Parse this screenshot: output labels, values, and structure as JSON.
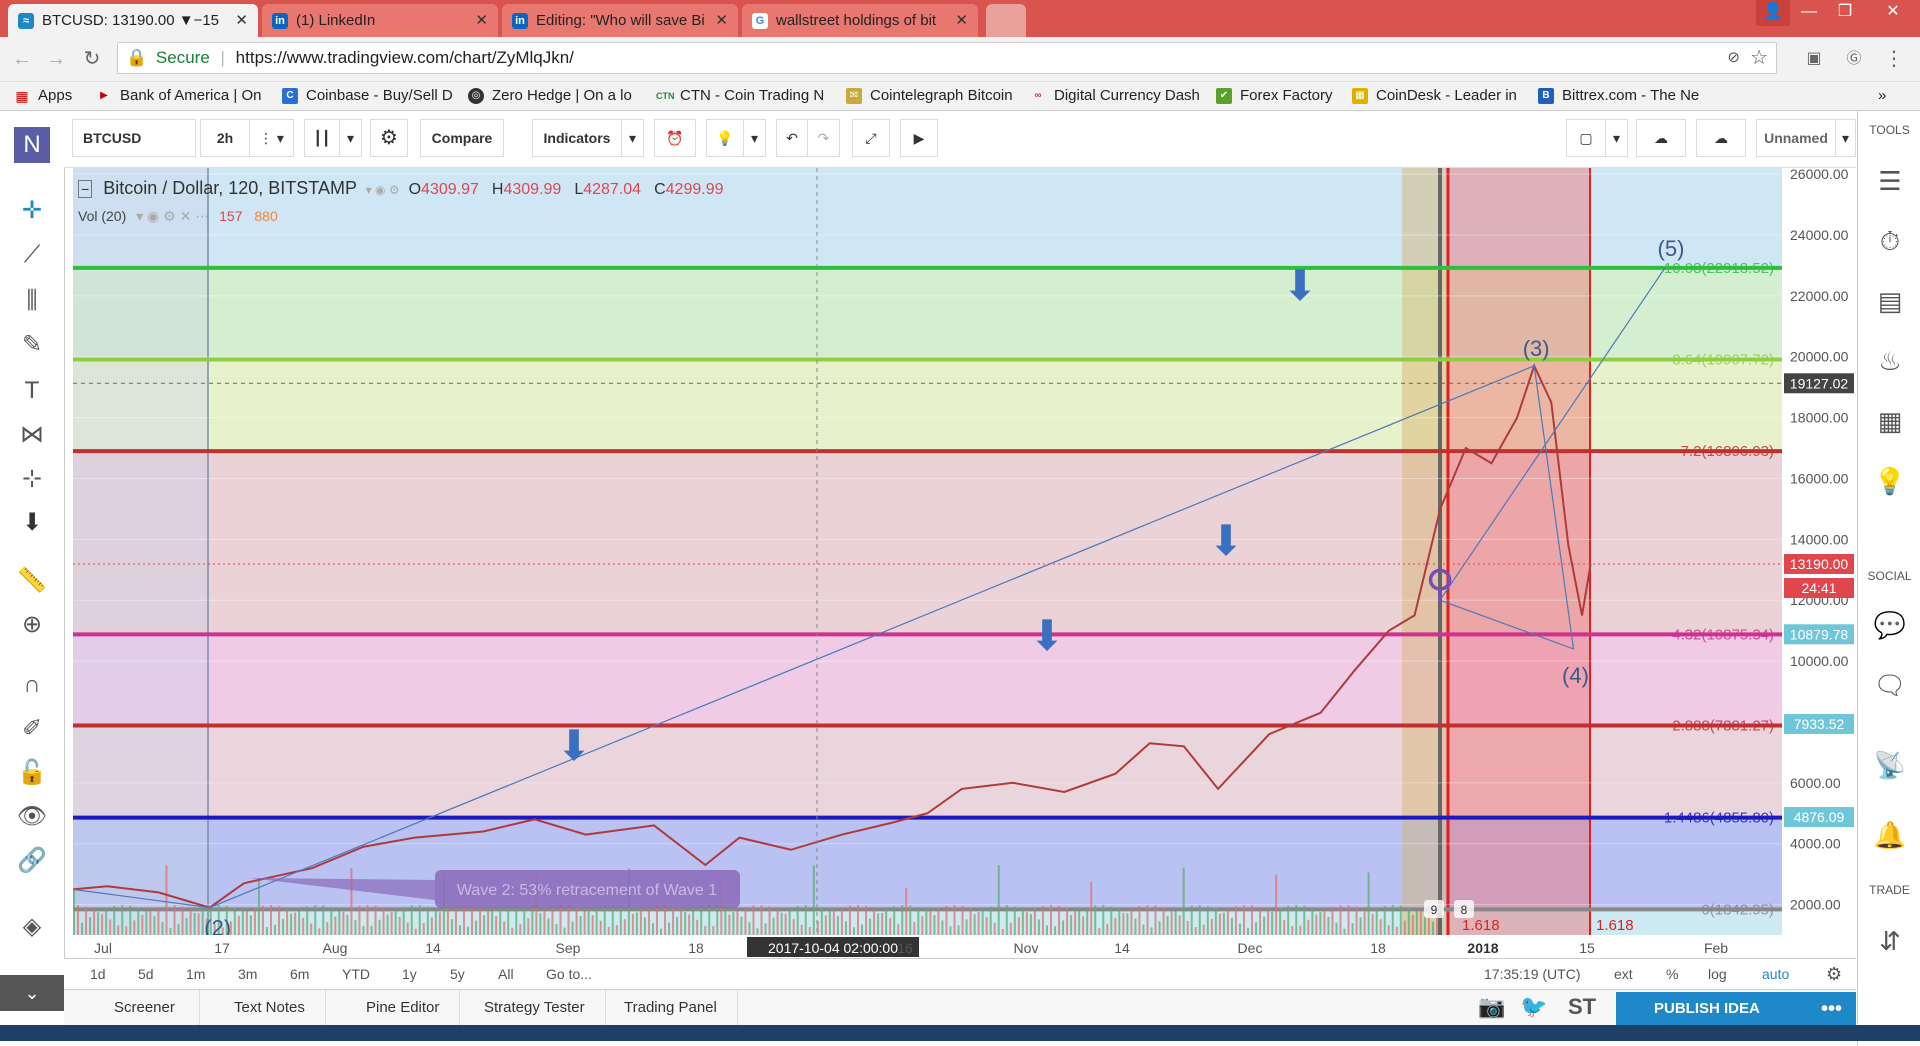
{
  "browser": {
    "tabs": [
      {
        "title": "BTCUSD: 13190.00 ▼−15",
        "fav": "tv",
        "active": true
      },
      {
        "title": "(1) LinkedIn",
        "fav": "in"
      },
      {
        "title": "Editing: \"Who will save Bi",
        "fav": "in"
      },
      {
        "title": "wallstreet holdings of bit",
        "fav": "G"
      }
    ],
    "secure_label": "Secure",
    "url": "https://www.tradingview.com/chart/ZyMlqJkn/",
    "bookmarks": [
      "Apps",
      "Bank of America | On",
      "Coinbase - Buy/Sell D",
      "Zero Hedge | On a lo",
      "CTN - Coin Trading N",
      "Cointelegraph Bitcoin",
      "Digital Currency Dash",
      "Forex Factory",
      "CoinDesk - Leader in",
      "Bittrex.com - The Ne"
    ]
  },
  "toolbar": {
    "symbol": "BTCUSD",
    "interval": "2h",
    "compare": "Compare",
    "indicators": "Indicators",
    "layout_name": "Unnamed"
  },
  "chart_legend": {
    "title": "Bitcoin / Dollar, 120, BITSTAMP",
    "o_label": "O",
    "o_value": "4309.97",
    "h_label": "H",
    "h_value": "4309.99",
    "l_label": "L",
    "l_value": "4287.04",
    "c_label": "C",
    "c_value": "4299.99",
    "vol_label": "Vol (20)",
    "vol_value1": "157",
    "vol_value2": "880"
  },
  "chart_data": {
    "type": "line",
    "x_ticks": [
      "Jul",
      "17",
      "Aug",
      "14",
      "Sep",
      "18",
      "2017-10-04 02:00:00",
      "16",
      "Nov",
      "14",
      "Dec",
      "18",
      "2018",
      "15",
      "Feb"
    ],
    "y_ticks": [
      "26000.00",
      "24000.00",
      "22000.00",
      "20000.00",
      "18000.00",
      "16000.00",
      "14000.00",
      "12000.00",
      "10000.00",
      "6000.00",
      "4000.00",
      "2000.00"
    ],
    "y_range": [
      1000,
      26200
    ],
    "price_path": [
      [
        0,
        2500
      ],
      [
        0.02,
        2600
      ],
      [
        0.05,
        2400
      ],
      [
        0.08,
        1900
      ],
      [
        0.1,
        2700
      ],
      [
        0.14,
        3200
      ],
      [
        0.17,
        3900
      ],
      [
        0.2,
        4200
      ],
      [
        0.24,
        4400
      ],
      [
        0.27,
        4800
      ],
      [
        0.3,
        4300
      ],
      [
        0.34,
        4600
      ],
      [
        0.37,
        3300
      ],
      [
        0.39,
        4200
      ],
      [
        0.42,
        3800
      ],
      [
        0.45,
        4300
      ],
      [
        0.48,
        4700
      ],
      [
        0.5,
        5000
      ],
      [
        0.52,
        5800
      ],
      [
        0.55,
        6000
      ],
      [
        0.58,
        5700
      ],
      [
        0.61,
        6300
      ],
      [
        0.63,
        7300
      ],
      [
        0.65,
        7200
      ],
      [
        0.67,
        5800
      ],
      [
        0.7,
        7600
      ],
      [
        0.73,
        8300
      ],
      [
        0.75,
        9700
      ],
      [
        0.77,
        11000
      ],
      [
        0.785,
        11500
      ],
      [
        0.8,
        15000
      ],
      [
        0.815,
        17000
      ],
      [
        0.83,
        16500
      ],
      [
        0.845,
        18000
      ],
      [
        0.855,
        19700
      ],
      [
        0.865,
        18500
      ],
      [
        0.875,
        13800
      ],
      [
        0.883,
        11500
      ],
      [
        0.888,
        13190
      ]
    ],
    "fib_levels": [
      {
        "label": "10.08(22918.52)",
        "value": 22918.52,
        "color": "#2fbf3f"
      },
      {
        "label": "8.64(19907.72)",
        "value": 19907.72,
        "color": "#8fcf3f"
      },
      {
        "label": "7.2(16896.93)",
        "value": 16896.93,
        "color": "#c0302f"
      },
      {
        "label": "4.32(10875.34)",
        "value": 10875.34,
        "color": "#d0308f"
      },
      {
        "label": "2.888(7881.27)",
        "value": 7881.27,
        "color": "#c0302f"
      },
      {
        "label": "1.4486(4855.80)",
        "value": 4855.8,
        "color": "#1a1ac0"
      },
      {
        "label": "0(1842.95)",
        "value": 1842.95,
        "color": "#888888"
      }
    ],
    "price_labels": [
      {
        "text": "19127.02",
        "value": 19127.02,
        "color": "#444444"
      },
      {
        "text": "13190.00",
        "value": 13190,
        "color": "#e0474c"
      },
      {
        "text": "24:41",
        "value": 12400,
        "color": "#e0474c"
      },
      {
        "text": "10879.78",
        "value": 10879.78,
        "color": "#6fc6d8"
      },
      {
        "text": "7933.52",
        "value": 7933.52,
        "color": "#6fc6d8"
      },
      {
        "text": "4876.09",
        "value": 4876.09,
        "color": "#6fc6d8"
      }
    ],
    "wave_labels": [
      "(2)",
      "(3)",
      "(4)",
      "(5)"
    ],
    "callout": "Wave 2: 53% retracement of Wave 1",
    "fib_time_labels": [
      "1.618",
      "1.618"
    ],
    "badges": [
      "9",
      "8"
    ]
  },
  "timeframes": [
    "1d",
    "5d",
    "1m",
    "3m",
    "6m",
    "YTD",
    "1y",
    "5y",
    "All",
    "Go to..."
  ],
  "status": {
    "time": "17:35:19 (UTC)",
    "ext": "ext",
    "pct": "%",
    "log": "log",
    "auto": "auto"
  },
  "bottom_tabs": [
    "Screener",
    "Text Notes",
    "Pine Editor",
    "Strategy Tester",
    "Trading Panel"
  ],
  "publish": "PUBLISH IDEA",
  "right_panel": {
    "tools": "TOOLS",
    "social": "SOCIAL",
    "trade": "TRADE"
  },
  "colors": {
    "tab_strip": "#d9534f",
    "accent": "#1e88c8",
    "red": "#e0474c"
  }
}
